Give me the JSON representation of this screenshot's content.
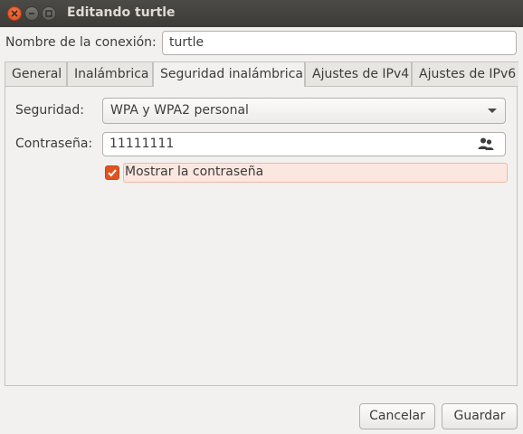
{
  "window": {
    "title": "Editando turtle"
  },
  "connection": {
    "name_label": "Nombre de la conexión:",
    "name_value": "turtle"
  },
  "tabs": [
    {
      "label": "General",
      "active": false
    },
    {
      "label": "Inalámbrica",
      "active": false
    },
    {
      "label": "Seguridad inalámbrica",
      "active": true
    },
    {
      "label": "Ajustes de IPv4",
      "active": false
    },
    {
      "label": "Ajustes de IPv6",
      "active": false
    }
  ],
  "security": {
    "security_label": "Seguridad:",
    "security_value": "WPA y WPA2 personal",
    "password_label": "Contraseña:",
    "password_value": "11111111",
    "password_icon": "users-icon",
    "show_password_label": "Mostrar la contraseña",
    "show_password_checked": true
  },
  "buttons": {
    "cancel_label": "Cancelar",
    "save_label": "Guardar"
  },
  "colors": {
    "accent": "#e1531f",
    "titlebar": "#3c3b37"
  }
}
